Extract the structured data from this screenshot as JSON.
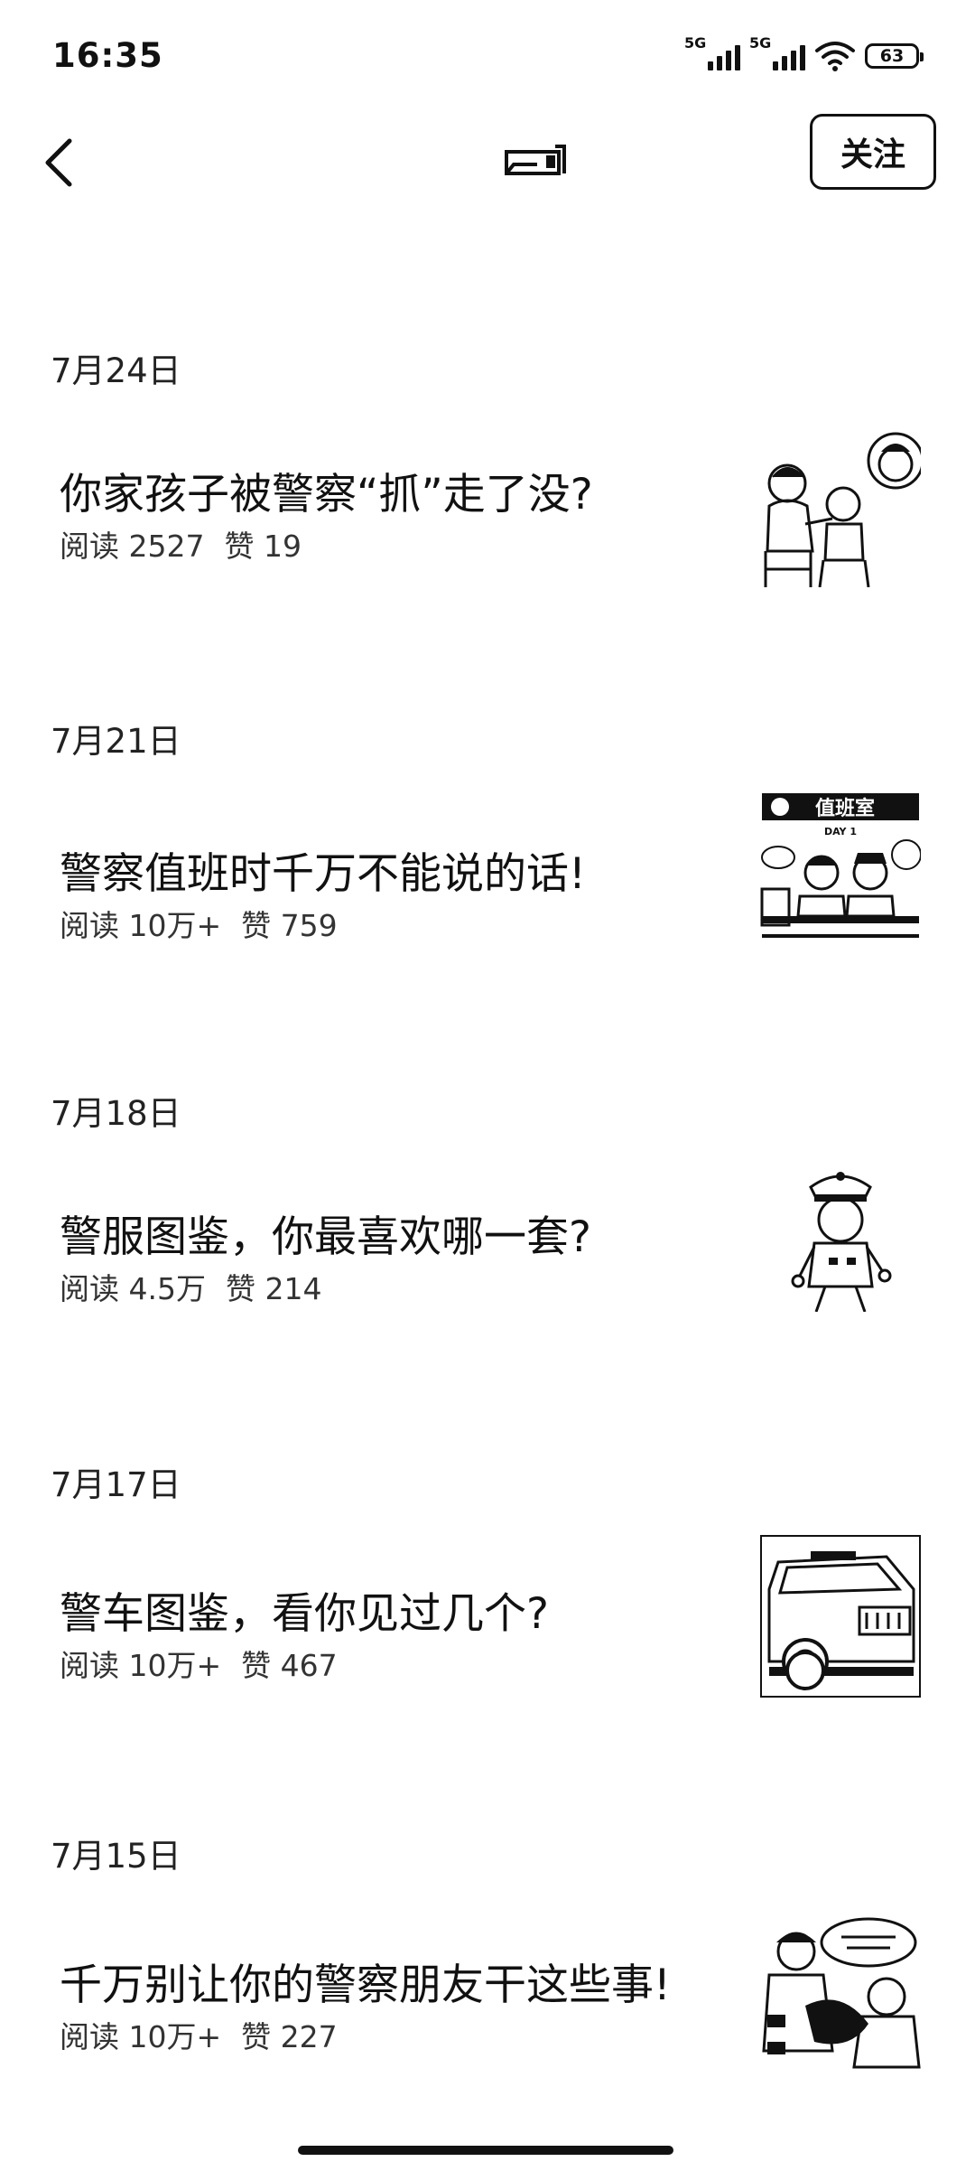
{
  "status_bar": {
    "time": "16:35",
    "signal1_label": "5G",
    "signal2_label": "5G",
    "battery": "63"
  },
  "nav": {
    "back_icon": "chevron-left-icon",
    "follow_label": "关注"
  },
  "articles": [
    {
      "date": "7月24日",
      "title": "你家孩子被警察“抓”走了没?",
      "reads_label": "阅读",
      "reads": "2527",
      "likes_label": "赞",
      "likes": "19",
      "thumb_icon": "family-illustration"
    },
    {
      "date": "7月21日",
      "title": "警察值班时千万不能说的话!",
      "reads_label": "阅读",
      "reads": "10万+",
      "likes_label": "赞",
      "likes": "759",
      "thumb_icon": "duty-room-illustration",
      "thumb_text": "值班室",
      "thumb_sub": "DAY 1"
    },
    {
      "date": "7月18日",
      "title": "警服图鉴，你最喜欢哪一套?",
      "reads_label": "阅读",
      "reads": "4.5万",
      "likes_label": "赞",
      "likes": "214",
      "thumb_icon": "police-uniform-illustration"
    },
    {
      "date": "7月17日",
      "title": "警车图鉴，看你见过几个?",
      "reads_label": "阅读",
      "reads": "10万+",
      "likes_label": "赞",
      "likes": "467",
      "thumb_icon": "police-car-illustration"
    },
    {
      "date": "7月15日",
      "title": "千万别让你的警察朋友干这些事!",
      "reads_label": "阅读",
      "reads": "10万+",
      "likes_label": "赞",
      "likes": "227",
      "thumb_icon": "police-friend-illustration"
    }
  ]
}
